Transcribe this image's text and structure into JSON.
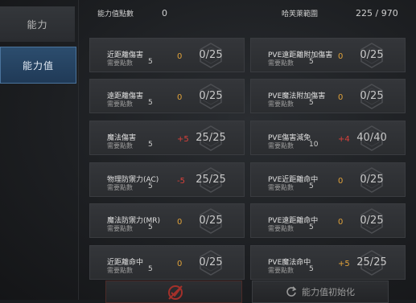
{
  "sidebar": {
    "items": [
      {
        "label": "能力"
      },
      {
        "label": "能力值"
      }
    ]
  },
  "header": {
    "points_label": "能力值點數",
    "points_value": "0",
    "range_label": "哈芙萊範圍",
    "range_value": "225 / 970"
  },
  "cards": [
    {
      "name": "近距離傷害",
      "req_label": "需要點數",
      "req": "5",
      "add": "0",
      "add_color": "orange",
      "ratio": "0/25"
    },
    {
      "name": "PVE遠距離附加傷害",
      "req_label": "需要點數",
      "req": "5",
      "add": "0",
      "add_color": "orange",
      "ratio": "0/25"
    },
    {
      "name": "遠距離傷害",
      "req_label": "需要點數",
      "req": "5",
      "add": "0",
      "add_color": "orange",
      "ratio": "0/25"
    },
    {
      "name": "PVE魔法附加傷害",
      "req_label": "需要點數",
      "req": "5",
      "add": "0",
      "add_color": "orange",
      "ratio": "0/25"
    },
    {
      "name": "魔法傷害",
      "req_label": "需要點數",
      "req": "5",
      "add": "+5",
      "add_color": "red",
      "ratio": "25/25"
    },
    {
      "name": "PVE傷害減免",
      "req_label": "需要點數",
      "req": "10",
      "add": "+4",
      "add_color": "red",
      "ratio": "40/40"
    },
    {
      "name": "物理防禦力(AC)",
      "req_label": "需要點數",
      "req": "5",
      "add": "-5",
      "add_color": "red",
      "ratio": "25/25"
    },
    {
      "name": "PVE近距離命中",
      "req_label": "需要點數",
      "req": "5",
      "add": "0",
      "add_color": "orange",
      "ratio": "0/25"
    },
    {
      "name": "魔法防禦力(MR)",
      "req_label": "需要點數",
      "req": "5",
      "add": "0",
      "add_color": "orange",
      "ratio": "0/25"
    },
    {
      "name": "PVE遠距離命中",
      "req_label": "需要點數",
      "req": "5",
      "add": "0",
      "add_color": "orange",
      "ratio": "0/25"
    },
    {
      "name": "近距離命中",
      "req_label": "需要點數",
      "req": "5",
      "add": "0",
      "add_color": "orange",
      "ratio": "0/25"
    },
    {
      "name": "PVE魔法命中",
      "req_label": "需要點數",
      "req": "5",
      "add": "+5",
      "add_color": "orange",
      "ratio": "25/25"
    }
  ],
  "bottom": {
    "confirm_icon": "crossed-out-check-icon",
    "reset_icon": "refresh-icon",
    "reset_label": "能力值初始化"
  }
}
